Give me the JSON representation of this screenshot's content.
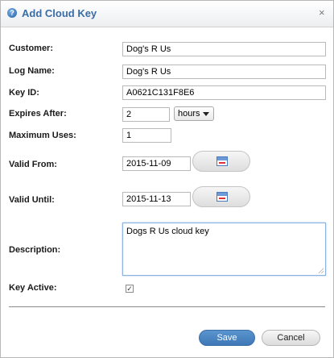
{
  "dialog": {
    "title": "Add Cloud Key",
    "title_icon": "help-circle-icon",
    "close_glyph": "×"
  },
  "form": {
    "customer": {
      "label": "Customer:",
      "value": "Dog's R Us"
    },
    "log_name": {
      "label": "Log Name:",
      "value": "Dog's R Us"
    },
    "key_id": {
      "label": "Key ID:",
      "value": "A0621C131F8E6"
    },
    "expires_after": {
      "label": "Expires After:",
      "value": "2",
      "unit": "hours"
    },
    "maximum_uses": {
      "label": "Maximum Uses:",
      "value": "1"
    },
    "valid_from": {
      "label": "Valid From:",
      "value": "2015-11-09"
    },
    "valid_until": {
      "label": "Valid Until:",
      "value": "2015-11-13"
    },
    "description": {
      "label": "Description:",
      "value": "Dogs R Us cloud key"
    },
    "key_active": {
      "label": "Key Active:",
      "checked": true,
      "check_glyph": "✓"
    }
  },
  "buttons": {
    "save": "Save",
    "cancel": "Cancel"
  },
  "colors": {
    "title": "#3a6ca5",
    "save_button": "#4a86c3"
  }
}
